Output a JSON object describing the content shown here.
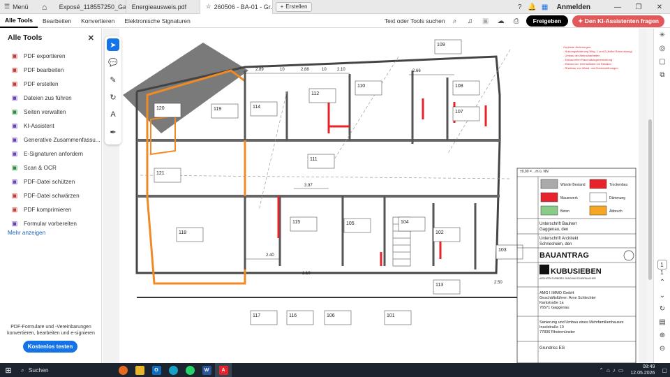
{
  "tabbar": {
    "menu_label": "Menü",
    "tabs": [
      {
        "label": "Exposé_118557250_Gagg...",
        "closable": false,
        "active": false
      },
      {
        "label": "Energieausweis.pdf",
        "closable": false,
        "active": false
      },
      {
        "label": "260506 - BA-01 - Gr...",
        "closable": true,
        "active": true
      }
    ],
    "new_label": "Erstellen",
    "login_label": "Anmelden"
  },
  "toolbar": {
    "menu": [
      "Alle Tools",
      "Bearbeiten",
      "Konvertieren",
      "Elektronische Signaturen"
    ],
    "search_label": "Text oder Tools suchen",
    "share_label": "Freigeben",
    "ai_label": "Den KI-Assistenten fragen"
  },
  "sidebar": {
    "title": "Alle Tools",
    "items": [
      {
        "label": "PDF exportieren",
        "icon": "export-pdf-icon",
        "color": "#c23b3b"
      },
      {
        "label": "PDF bearbeiten",
        "icon": "edit-pdf-icon",
        "color": "#c23b3b"
      },
      {
        "label": "PDF erstellen",
        "icon": "create-pdf-icon",
        "color": "#c23b3b"
      },
      {
        "label": "Dateien zus führen",
        "icon": "combine-files-icon",
        "color": "#6b3fb5"
      },
      {
        "label": "Seiten verwalten",
        "icon": "organize-pages-icon",
        "color": "#2e8b3a"
      },
      {
        "label": "KI-Assistent",
        "icon": "ai-assistant-icon",
        "color": "#6b3fb5"
      },
      {
        "label": "Generative Zusammenfassu...",
        "icon": "summary-icon",
        "color": "#6b3fb5"
      },
      {
        "label": "E-Signaturen anfordern",
        "icon": "signature-icon",
        "color": "#6b3fb5"
      },
      {
        "label": "Scan & OCR",
        "icon": "scan-icon",
        "color": "#2e8b3a"
      },
      {
        "label": "PDF-Datei schützen",
        "icon": "protect-icon",
        "color": "#6b3fb5"
      },
      {
        "label": "PDF-Datei schwärzen",
        "icon": "redact-icon",
        "color": "#c23b3b"
      },
      {
        "label": "PDF komprimieren",
        "icon": "compress-icon",
        "color": "#c23b3b"
      },
      {
        "label": "Formular vorbereiten",
        "icon": "form-icon",
        "color": "#6b3fb5"
      }
    ],
    "more_label": "Mehr anzeigen",
    "promo_text": "PDF-Formulare und -Vereinbarungen konvertieren, bearbeiten und e-signieren",
    "trial_label": "Kostenlos testen"
  },
  "plan": {
    "legend_items": [
      "Wände Bestand",
      "Trockenbau",
      "Mauerwerk",
      "Dämmung",
      "Beton",
      "Abbruch"
    ],
    "legend_colors": [
      "#aaaaaa",
      "#e8222a",
      "#e8222a",
      "#ffffff",
      "#88cc88",
      "#f5a623"
    ],
    "level_note": "±0,00 = ...m ü. NN",
    "owner_label": "Unterschrift Bauherr",
    "owner_place": "Gaggenau, den",
    "architect_label": "Unterschrift Architekt",
    "architect_place": "Schriesheim, den",
    "title": "BAUANTRAG",
    "firm_name": "KUBUSIEBEN",
    "firm_sub": "ARCHITEKTURBÜRO JOACHIM SCHEIRNACHER",
    "client_lines": [
      "AMG I IMMO GmbH",
      "Geschäftsführer: Arne Schlechter",
      "Kantstraße 1a",
      "76571 Gaggenau"
    ],
    "project_lines": [
      "Sanierung und Umbau eines Mehrfamilienhauses",
      "Inselstraße 10",
      "77836 Rheinmünster"
    ],
    "drawing_label": "Grundriss EG",
    "room_numbers": [
      "109",
      "110",
      "112",
      "114",
      "119",
      "120",
      "108",
      "107",
      "111",
      "121",
      "118",
      "115",
      "105",
      "104",
      "102",
      "103",
      "117",
      "116",
      "106",
      "101",
      "113"
    ],
    "dims": [
      "2.89",
      "10",
      "2.88",
      "10",
      "2.10",
      "2.66",
      "3.97",
      "2.40",
      "1.10",
      "2.50"
    ]
  },
  "rail": {
    "page_current": "1",
    "page_total": "1"
  },
  "taskbar": {
    "search_label": "Suchen",
    "time": "08:49",
    "date": "12.05.2026"
  }
}
